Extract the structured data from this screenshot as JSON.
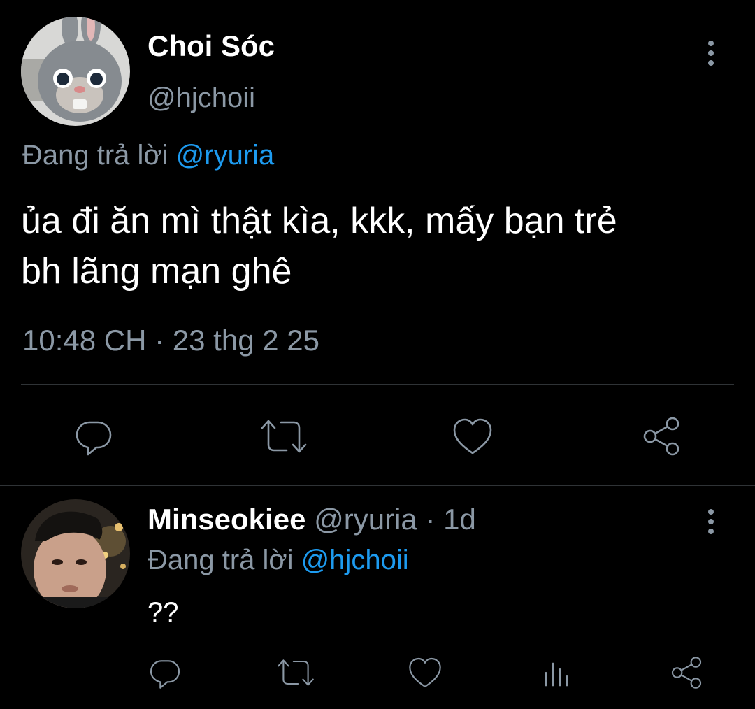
{
  "main_tweet": {
    "display_name": "Choi Sóc",
    "handle": "@hjchoii",
    "reply_prefix": "Đang trả lời",
    "reply_to": "@ryuria",
    "text_line1": "ủa đi ăn mì thật kìa, kkk, mấy bạn trẻ",
    "text_line2": "bh lãng mạn ghê",
    "time": "10:48 CH",
    "separator": "·",
    "date": "23 thg 2 25",
    "avatar_icon": "bunny-mascot-avatar",
    "actions": [
      "reply-icon",
      "retweet-icon",
      "like-icon",
      "share-icon"
    ]
  },
  "reply_tweet": {
    "display_name": "Minseokiee",
    "handle": "@ryuria",
    "separator": "·",
    "age": "1d",
    "reply_prefix": "Đang trả lời",
    "reply_to": "@hjchoii",
    "text": "??",
    "avatar_icon": "person-photo-avatar",
    "actions": [
      "reply-icon",
      "retweet-icon",
      "like-icon",
      "analytics-icon",
      "share-icon"
    ]
  },
  "colors": {
    "background": "#000000",
    "text": "#ffffff",
    "muted": "#8b98a5",
    "link": "#1d9bf0",
    "divider": "#2f3336"
  }
}
